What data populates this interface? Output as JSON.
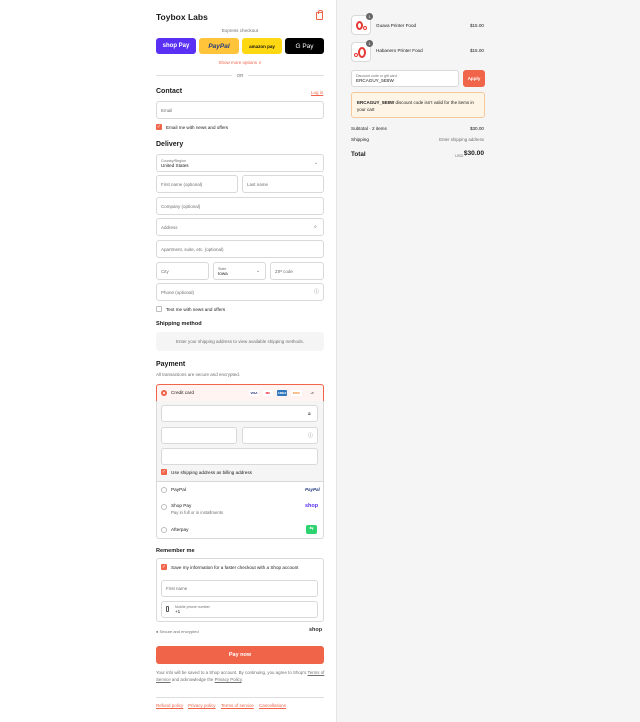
{
  "brand": "Toybox Labs",
  "express": {
    "label": "Express checkout",
    "shop_pay": "shop Pay",
    "paypal": "PayPal",
    "amazon_pay": "amazon pay",
    "google_pay": "G Pay",
    "show_more": "Show more options ∨",
    "or": "OR"
  },
  "contact": {
    "heading": "Contact",
    "login": "Log in",
    "email_placeholder": "Email",
    "email_opt_in": "Email me with news and offers"
  },
  "delivery": {
    "heading": "Delivery",
    "country_label": "Country/Region",
    "country_value": "United States",
    "first_name": "First name (optional)",
    "last_name": "Last name",
    "company": "Company (optional)",
    "address": "Address",
    "apartment": "Apartment, suite, etc. (optional)",
    "city": "City",
    "state_label": "State",
    "state_value": "Iowa",
    "zip": "ZIP code",
    "phone": "Phone (optional)",
    "text_opt_in": "Text me with news and offers"
  },
  "shipping_method": {
    "heading": "Shipping method",
    "message": "Enter your shipping address to view available shipping methods."
  },
  "payment": {
    "heading": "Payment",
    "subtitle": "All transactions are secure and encrypted.",
    "credit_card": "Credit card",
    "card_badges": [
      "VISA",
      "MC",
      "AMEX",
      "DISC",
      "+5"
    ],
    "use_shipping_billing": "Use shipping address as billing address",
    "paypal": "PayPal",
    "paypal_logo": "PayPal",
    "shop_pay": "Shop Pay",
    "shop_pay_sub": "Pay in full or in installments",
    "shop_logo": "shop",
    "afterpay": "Afterpay",
    "afterpay_logo": "⇆"
  },
  "remember": {
    "heading": "Remember me",
    "save_info": "Save my information for a faster checkout with a Shop account",
    "first_name": "First name",
    "mobile_label": "Mobile phone number",
    "mobile_value": "+1",
    "secure": "Secure and encrypted",
    "shop": "shop"
  },
  "pay_now": "Pay now",
  "legal": {
    "text_1": "Your info will be saved to a Shop account. By continuing, you agree to Shop’s",
    "terms": "Terms of Service",
    "text_2": "and acknowledge the",
    "privacy": "Privacy Policy",
    "end": "."
  },
  "footer_links": [
    "Refund policy",
    "Privacy policy",
    "Terms of service",
    "Cancellations"
  ],
  "summary": {
    "items": [
      {
        "name": "Guava Printer Food",
        "qty": "1",
        "price": "$15.00"
      },
      {
        "name": "Habanero Printer Food",
        "qty": "1",
        "price": "$15.00"
      }
    ],
    "discount_label": "Discount code or gift card",
    "discount_value": "ERCAGUY_5E8W",
    "apply": "Apply",
    "error_code": "ERCAGUY_5E8W",
    "error_text": "discount code isn’t valid for the items in your cart",
    "subtotal_label": "Subtotal · 2 items",
    "subtotal_value": "$30.00",
    "shipping_label": "Shipping",
    "shipping_value": "Enter shipping address",
    "total_label": "Total",
    "currency": "USD",
    "total_value": "$30.00"
  },
  "colors": {
    "accent": "#f06449",
    "shop_purple": "#5a31f4",
    "paypal_yellow": "#ffc439",
    "error_bg": "#fff5e6"
  }
}
